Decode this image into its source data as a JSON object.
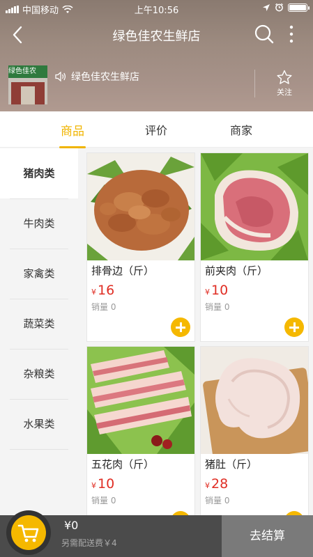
{
  "status_bar": {
    "carrier": "中国移动",
    "time": "上午10:56"
  },
  "nav": {
    "title": "绿色佳农生鲜店"
  },
  "store": {
    "name": "绿色佳农生鲜店",
    "sign_text": "绿色佳农",
    "follow_label": "关注"
  },
  "tabs": [
    {
      "label": "商品",
      "active": true
    },
    {
      "label": "评价",
      "active": false
    },
    {
      "label": "商家",
      "active": false
    }
  ],
  "categories": [
    {
      "label": "猪肉类",
      "active": true
    },
    {
      "label": "牛肉类",
      "active": false
    },
    {
      "label": "家禽类",
      "active": false
    },
    {
      "label": "蔬菜类",
      "active": false
    },
    {
      "label": "杂粮类",
      "active": false
    },
    {
      "label": "水果类",
      "active": false
    }
  ],
  "products": [
    {
      "name": "排骨边（斤）",
      "currency": "¥",
      "price": "16",
      "sales": "销量 0",
      "image": "marinated-ribs-image"
    },
    {
      "name": "前夹肉（斤）",
      "currency": "¥",
      "price": "10",
      "sales": "销量 0",
      "image": "pork-shoulder-image"
    },
    {
      "name": "五花肉（斤）",
      "currency": "¥",
      "price": "10",
      "sales": "销量 0",
      "image": "pork-belly-image"
    },
    {
      "name": "猪肚（斤）",
      "currency": "¥",
      "price": "28",
      "sales": "销量 0",
      "image": "pork-tripe-image"
    }
  ],
  "cart": {
    "total": "¥0",
    "delivery_note": "另需配送费￥4",
    "checkout_label": "去结算"
  },
  "colors": {
    "accent": "#f0b400",
    "price": "#e02e24",
    "cart_bar": "#4b4b4b",
    "checkout": "#7a7a7a"
  }
}
